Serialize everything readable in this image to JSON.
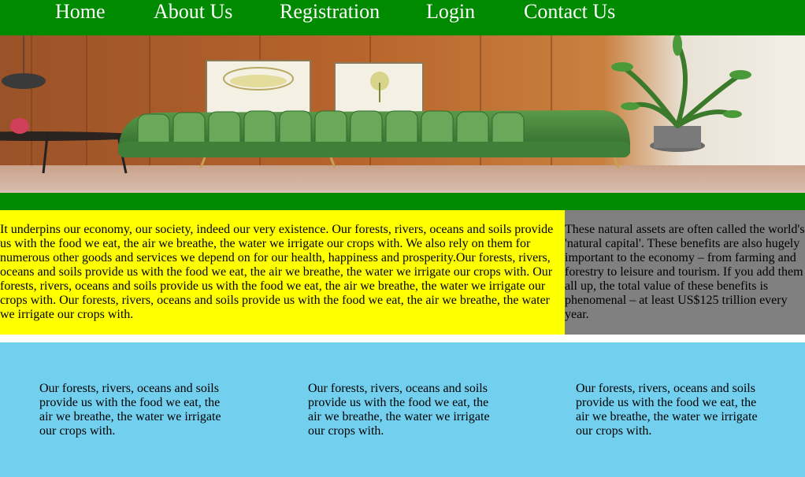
{
  "nav": {
    "items": [
      {
        "label": "Home"
      },
      {
        "label": "About Us"
      },
      {
        "label": "Registration"
      },
      {
        "label": "Login"
      },
      {
        "label": "Contact Us"
      }
    ]
  },
  "colors": {
    "nav_bg": "#008a00",
    "yellow": "#ffff00",
    "gray": "#808080",
    "light_blue": "#72cfee"
  },
  "hero": {
    "image_icon": "living-room-photo"
  },
  "content": {
    "left_text": "It underpins our economy, our society, indeed our very existence. Our forests, rivers, oceans and soils provide us with the food we eat, the air we breathe, the water we irrigate our crops with. We also rely on them for numerous other goods and services we depend on for our health, happiness and prosperity.Our forests, rivers, oceans and soils provide us with the food we eat, the air we breathe, the water we irrigate our crops with. Our forests, rivers, oceans and soils provide us with the food we eat, the air we breathe, the water we irrigate our crops with. Our forests, rivers, oceans and soils provide us with the food we eat, the air we breathe, the water we irrigate our crops with.",
    "right_text": "These natural assets are often called the world's 'natural capital'. These benefits are also hugely important to the economy – from farming and forestry to leisure and tourism. If you add them all up, the total value of these benefits is phenomenal – at least US$125 trillion every year."
  },
  "columns": [
    {
      "text": "Our forests, rivers, oceans and soils provide us with the food we eat, the air we breathe, the water we irrigate our crops with."
    },
    {
      "text": "Our forests, rivers, oceans and soils provide us with the food we eat, the air we breathe, the water we irrigate our crops with."
    },
    {
      "text": "Our forests, rivers, oceans and soils provide us with the food we eat, the air we breathe, the water we irrigate our crops with."
    }
  ]
}
